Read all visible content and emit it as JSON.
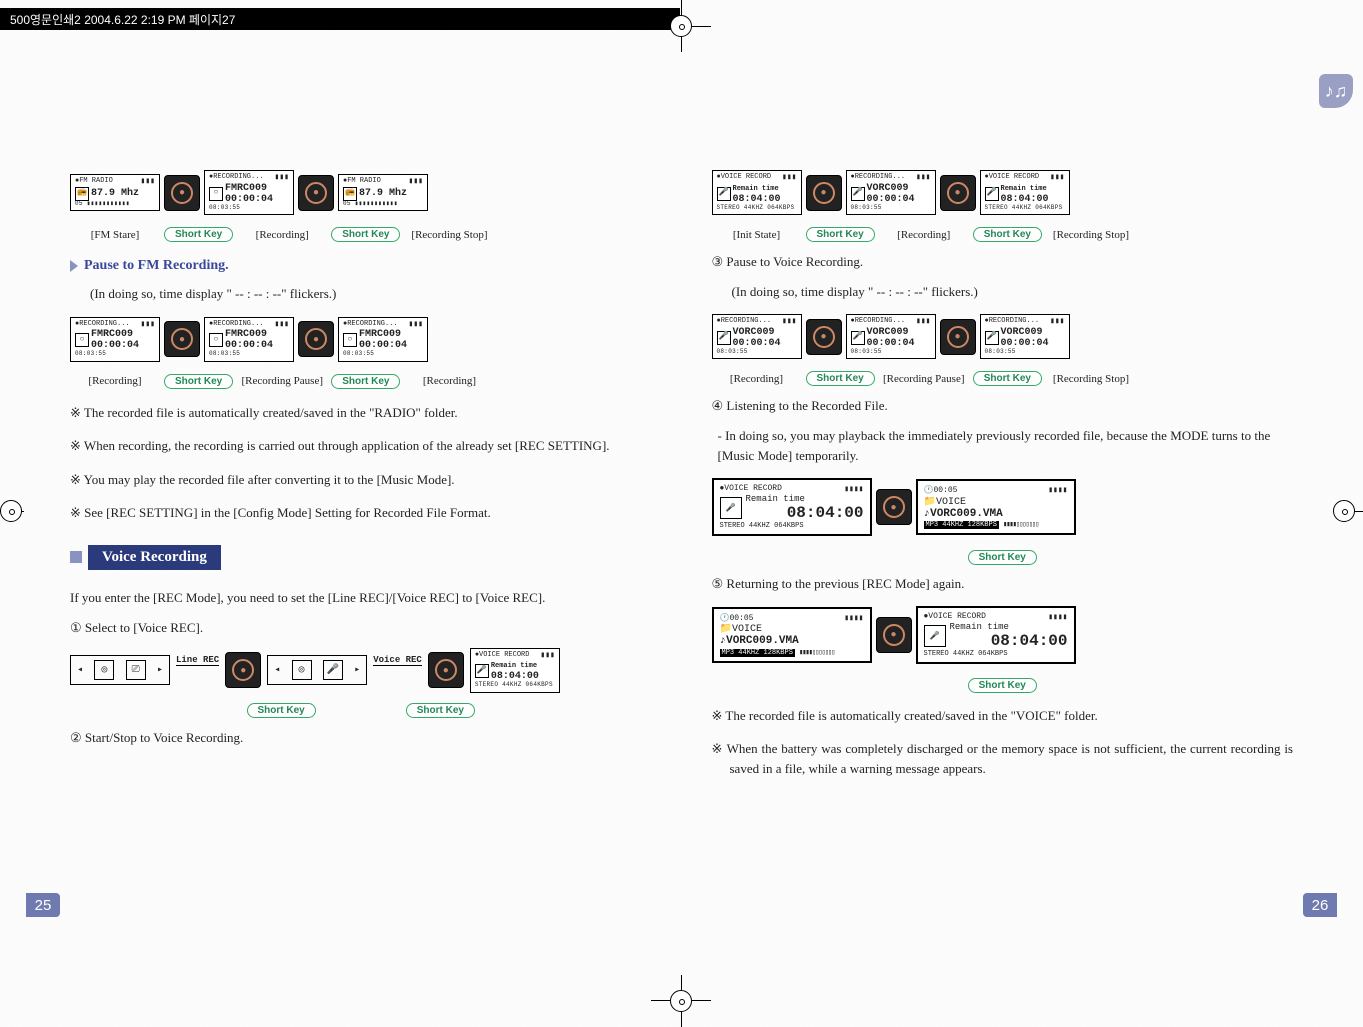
{
  "header": {
    "text": "500영문인쇄2  2004.6.22 2:19 PM  페이지27"
  },
  "left": {
    "row1": {
      "lcd1": {
        "top": "●FM RADIO",
        "mid": "87.9 Mhz",
        "bot": "05 ▮▮▮▮▮▮▮▮▮▮▮"
      },
      "lcd2": {
        "top": "●RECORDING...",
        "mid1": "FMRC009",
        "mid2": "00:00:04",
        "bot": "08:03:55"
      },
      "lcd3": {
        "top": "●FM RADIO",
        "mid": "87.9 Mhz",
        "bot": "05 ▮▮▮▮▮▮▮▮▮▮▮"
      },
      "caps": [
        "[FM Stare]",
        "[Recording]",
        "[Recording Stop]"
      ]
    },
    "pause_heading": "Pause to FM Recording.",
    "pause_sub": "(In doing so, time display \" --  : -- : --\"  flickers.)",
    "row2": {
      "lcd1": {
        "top": "●RECORDING...",
        "mid1": "FMRC009",
        "mid2": "00:00:04",
        "bot": "08:03:55"
      },
      "lcd2": {
        "top": "●RECORDING...",
        "mid1": "FMRC009",
        "mid2": "00:00:04",
        "bot": "08:03:55"
      },
      "lcd3": {
        "top": "●RECORDING...",
        "mid1": "FMRC009",
        "mid2": "00:00:04",
        "bot": "08:03:55"
      },
      "caps": [
        "[Recording]",
        "[Recording Pause]",
        "[Recording]"
      ]
    },
    "notes": [
      "The recorded file is automatically created/saved in the \"RADIO\" folder.",
      "When recording, the recording is carried out through application of the already set [REC SETTING].",
      "You may play the recorded file after converting it to the [Music Mode].",
      "See [REC SETTING] in the [Config Mode] Setting for Recorded File Format."
    ],
    "section_title": "Voice Recording",
    "section_intro": "If you enter the [REC Mode], you need to set the [Line REC]/[Voice REC] to [Voice REC].",
    "step1": "① Select to [Voice REC].",
    "selrow": {
      "sel1": "Line REC",
      "sel2": "Voice REC",
      "lcd": {
        "top": "●VOICE RECORD",
        "mid1": "Remain time",
        "mid2": "08:04:00",
        "bot": "STEREO 44KHZ 064KBPS"
      }
    },
    "step2": "② Start/Stop to Voice Recording.",
    "pagenum": "25",
    "shortkey": "Short Key"
  },
  "right": {
    "row1": {
      "lcd1": {
        "top": "●VOICE RECORD",
        "mid1": "Remain time",
        "mid2": "08:04:00",
        "bot": "STEREO 44KHZ 064KBPS"
      },
      "lcd2": {
        "top": "●RECORDING...",
        "mid1": "VORC009",
        "mid2": "00:00:04",
        "bot": "08:03:55"
      },
      "lcd3": {
        "top": "●VOICE RECORD",
        "mid1": "Remain time",
        "mid2": "08:04:00",
        "bot": "STEREO 44KHZ 064KBPS"
      },
      "caps": [
        "[Init State]",
        "[Recording]",
        "[Recording Stop]"
      ]
    },
    "step3": "③ Pause to Voice Recording.",
    "step3_sub": "(In doing so, time display \" --  : -- : --\"  flickers.)",
    "row2": {
      "lcd1": {
        "top": "●RECORDING...",
        "mid1": "VORC009",
        "mid2": "00:00:04",
        "bot": "08:03:55"
      },
      "lcd2": {
        "top": "●RECORDING...",
        "mid1": "VORC009",
        "mid2": "00:00:04",
        "bot": "08:03:55"
      },
      "lcd3": {
        "top": "●RECORDING...",
        "mid1": "VORC009",
        "mid2": "00:00:04",
        "bot": "08:03:55"
      },
      "caps": [
        "[Recording]",
        "[Recording Pause]",
        "[Recording Stop]"
      ]
    },
    "step4": "④ Listening to the Recorded File.",
    "step4_body": "- In doing so, you may playback the immediately previously recorded file, because the MODE turns to the [Music Mode] temporarily.",
    "big1": {
      "top": "●VOICE RECORD",
      "mid1": "Remain time",
      "mid2": "08:04:00",
      "bot": "STEREO  44KHZ  064KBPS"
    },
    "big2": {
      "time": "00:05",
      "folder": "VOICE",
      "file": "VORC009.VMA",
      "tags": "MP3 44KHZ 128KBPS"
    },
    "step5": "⑤ Returning to the previous [REC Mode] again.",
    "notes": [
      "The recorded file is automatically created/saved in the \"VOICE\" folder.",
      "When the battery was completely discharged or the memory space is not sufficient, the current recording is saved in a file, while a warning message appears."
    ],
    "pagenum": "26",
    "shortkey": "Short Key"
  }
}
